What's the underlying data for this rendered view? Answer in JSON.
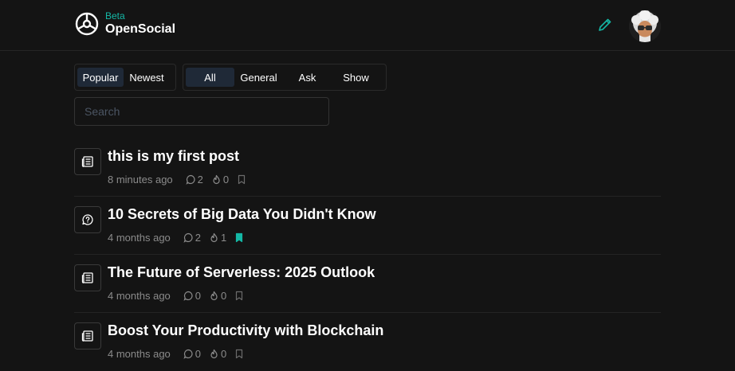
{
  "brand": {
    "beta_label": "Beta",
    "name": "OpenSocial"
  },
  "sort_tabs": [
    {
      "label": "Popular",
      "active": true
    },
    {
      "label": "Newest",
      "active": false
    }
  ],
  "category_tabs": [
    {
      "label": "All",
      "active": true
    },
    {
      "label": "General",
      "active": false
    },
    {
      "label": "Ask",
      "active": false
    },
    {
      "label": "Show",
      "active": false
    }
  ],
  "search": {
    "placeholder": "Search",
    "value": ""
  },
  "posts": [
    {
      "icon": "newspaper-icon",
      "title": "this is my first post",
      "time": "8 minutes ago",
      "comments": "2",
      "likes": "0",
      "bookmarked": false
    },
    {
      "icon": "chat-question-icon",
      "title": "10 Secrets of Big Data You Didn't Know",
      "time": "4 months ago",
      "comments": "2",
      "likes": "1",
      "bookmarked": true
    },
    {
      "icon": "newspaper-icon",
      "title": "The Future of Serverless: 2025 Outlook",
      "time": "4 months ago",
      "comments": "0",
      "likes": "0",
      "bookmarked": false
    },
    {
      "icon": "newspaper-icon",
      "title": "Boost Your Productivity with Blockchain",
      "time": "4 months ago",
      "comments": "0",
      "likes": "0",
      "bookmarked": false
    }
  ],
  "colors": {
    "accent": "#14b8a6",
    "background": "#141414",
    "muted_text": "#8b8b8b",
    "active_tab": "#1f2937"
  }
}
